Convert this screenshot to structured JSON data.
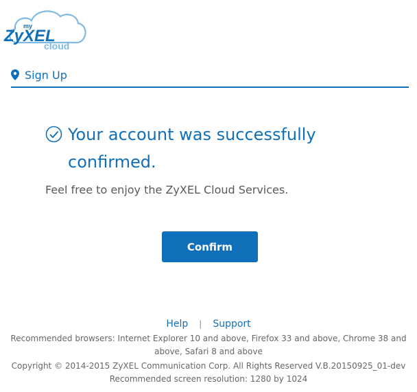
{
  "logo": {
    "prefix": "my",
    "brand": "ZyXEL",
    "suffix": "cloud"
  },
  "nav": {
    "title": "Sign Up",
    "icon": "map-pin-icon"
  },
  "message": {
    "headline": "Your account was successfully confirmed.",
    "subtext": "Feel free to enjoy the ZyXEL Cloud Services.",
    "icon": "check-circle-icon"
  },
  "actions": {
    "confirm_label": "Confirm"
  },
  "footer": {
    "help_label": "Help",
    "separator": "|",
    "support_label": "Support",
    "browsers": "Recommended browsers: Internet Explorer 10 and above, Firefox 33 and above, Chrome 38 and above, Safari 8 and above",
    "copyright": "Copyright © 2014-2015 ZyXEL Communication Corp. All Rights Reserved V.B.20150925_01-dev",
    "resolution": "Recommended screen resolution: 1280 by 1024"
  },
  "colors": {
    "brand_blue": "#0f6fb8",
    "cloud_blue": "#7fb9e3",
    "text_gray": "#595959"
  }
}
